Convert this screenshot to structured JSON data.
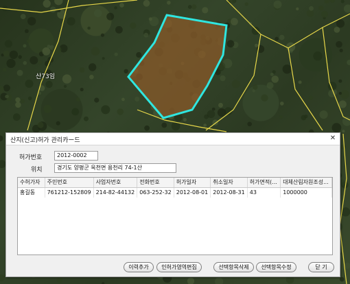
{
  "map": {
    "parcel_label": "산73임",
    "colors": {
      "parcel_outline": "#2fe6e0",
      "parcel_fill": "#8a5a2a",
      "boundary_line": "#e8d84a"
    }
  },
  "dialog": {
    "title": "산지(신고)허가 관리카ー드",
    "close_icon": "✕",
    "permit_no_label": "허가번호",
    "permit_no_value": "2012-0002",
    "location_label": "위치",
    "location_value": "경기도 양평군 옥천면 용천리 74-1산"
  },
  "table": {
    "columns": [
      "수허가자",
      "주민번호",
      "사업자번호",
      "전화번호",
      "허가일자",
      "취소일자",
      "허가면적(...",
      "대체산림자원조성..."
    ],
    "rows": [
      [
        "홍길동",
        "761212-152809",
        "214-82-44132",
        "063-252-32",
        "2012-08-01",
        "2012-08-31",
        "43",
        "1000000"
      ]
    ]
  },
  "buttons": {
    "history_add": "이력추가",
    "area_edit": "인허가영역편집",
    "delete_selected": "선택항목삭제",
    "edit_selected": "선택항목수정",
    "close": "닫 기"
  }
}
